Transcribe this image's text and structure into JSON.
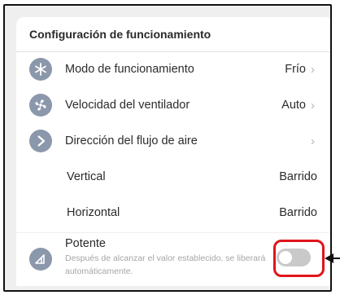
{
  "header": {
    "title": "Configuración de funcionamiento"
  },
  "rows": [
    {
      "label": "Modo de funcionamiento",
      "value": "Frío",
      "icon": "snowflake-icon"
    },
    {
      "label": "Velocidad del ventilador",
      "value": "Auto",
      "icon": "fan-icon"
    },
    {
      "label": "Dirección del flujo de aire",
      "value": "",
      "icon": "airflow-icon"
    }
  ],
  "sub_rows": [
    {
      "label": "Vertical",
      "value": "Barrido"
    },
    {
      "label": "Horizontal",
      "value": "Barrido"
    }
  ],
  "potente": {
    "title": "Potente",
    "description": "Después de alcanzar el valor establecido, se liberará automáticamente.",
    "enabled": false,
    "icon": "powerful-icon"
  },
  "chevron": "›",
  "colors": {
    "icon_bg": "#8b97aa",
    "highlight": "#e1141b",
    "toggle_off": "#c9c9c9"
  }
}
